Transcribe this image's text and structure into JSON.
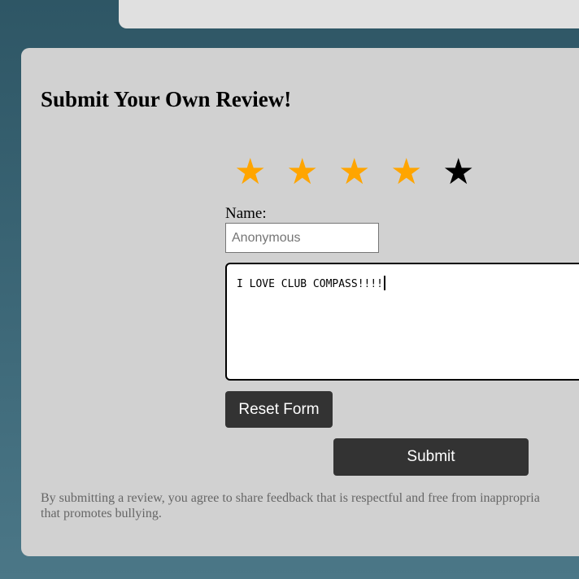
{
  "form": {
    "title": "Submit Your Own Review!",
    "rating": 4,
    "max_rating": 5,
    "star_color_on": "#ffa500",
    "star_color_off": "#000000",
    "stars": [
      "★",
      "★",
      "★",
      "★",
      "★"
    ],
    "name_label": "Name:",
    "name_placeholder": "Anonymous",
    "name_value": "",
    "review_value": "I LOVE CLUB COMPASS!!!!",
    "reset_label": "Reset Form",
    "submit_label": "Submit",
    "disclaimer_line1": "By submitting a review, you agree to share feedback that is respectful and free from inappropria",
    "disclaimer_line2": "that promotes bullying."
  }
}
